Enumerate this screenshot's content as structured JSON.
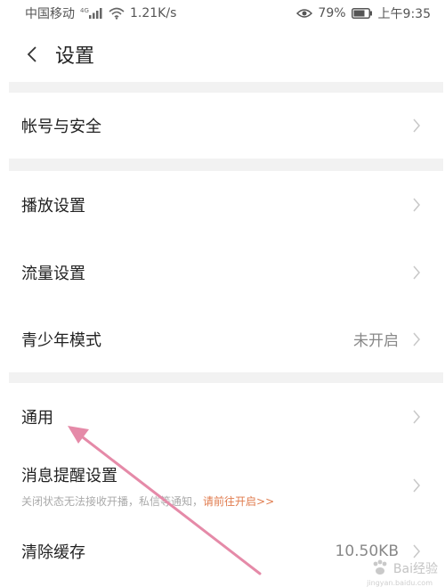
{
  "status_bar": {
    "carrier": "中国移动",
    "network_tag": "4G",
    "speed": "1.21K/s",
    "battery_percent": "79%",
    "time": "上午9:35",
    "icons": [
      "signal-bars-icon",
      "wifi-icon",
      "eye-icon",
      "battery-icon"
    ]
  },
  "header": {
    "title": "设置",
    "back_icon": "chevron-left-icon"
  },
  "sections": [
    {
      "rows": [
        {
          "label": "帐号与安全"
        }
      ]
    },
    {
      "rows": [
        {
          "label": "播放设置"
        },
        {
          "label": "流量设置"
        },
        {
          "label": "青少年模式",
          "value": "未开启"
        }
      ]
    },
    {
      "rows": [
        {
          "label": "通用"
        },
        {
          "label": "消息提醒设置",
          "sub_text": "关闭状态无法接收开播，私信等通知，",
          "sub_link": "请前往开启>>"
        },
        {
          "label": "清除缓存",
          "value": "10.50KB"
        }
      ]
    }
  ],
  "colors": {
    "accent_link": "#e07b4d",
    "annotation_arrow": "#e58aa8",
    "section_gap": "#f2f2f2"
  },
  "watermark": {
    "text": "Bai经验",
    "sub_text": "jingyan.baidu.com"
  }
}
